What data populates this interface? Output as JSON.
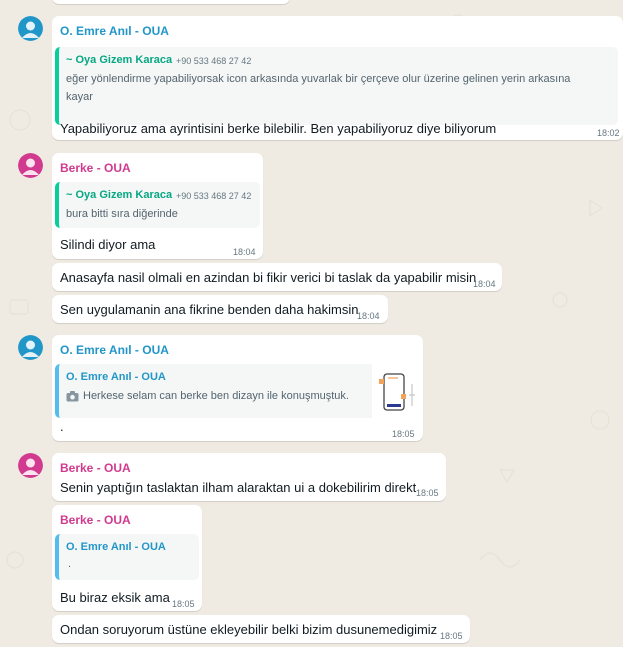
{
  "colors": {
    "background": "#efeae2",
    "bubble": "#ffffff",
    "emre": "#2196c8",
    "berke": "#d13a8e",
    "oya": "#06a884",
    "timestamp": "#667781"
  },
  "messages": {
    "m1": {
      "sender": "O. Emre Anıl - OUA",
      "quote_name": "~ Oya Gizem Karaca",
      "quote_phone": "+90 533 468 27 42",
      "quote_line1": "eğer yönlendirme yapabiliyorsak icon arkasında yuvarlak bir çerçeve olur üzerine gelinen yerin arkasına",
      "quote_line2": "kayar",
      "text": "Yapabiliyoruz ama ayrintisini berke bilebilir. Ben yapabiliyoruz diye biliyorum",
      "time": "18:02"
    },
    "m2": {
      "sender": "Berke - OUA",
      "quote_name": "~ Oya Gizem Karaca",
      "quote_phone": "+90 533 468 27 42",
      "quote_text": "bura bitti sıra diğerinde",
      "text": "Silindi diyor ama",
      "time": "18:04"
    },
    "m3": {
      "text": "Anasayfa nasil olmali en azindan bi fikir verici bi taslak da yapabilir misin",
      "time": "18:04"
    },
    "m4": {
      "text": "Sen uygulamanin ana fikrine benden daha hakimsin",
      "time": "18:04"
    },
    "m5": {
      "sender": "O. Emre Anıl - OUA",
      "quote_name": "O. Emre Anıl - OUA",
      "quote_text": "Herkese selam can berke ben dizayn ile konuşmuştuk.",
      "text": ".",
      "time": "18:05"
    },
    "m6": {
      "sender": "Berke - OUA",
      "text": "Senin yaptığın taslaktan ilham alaraktan ui a dokebilirim direkt",
      "time": "18:05"
    },
    "m7": {
      "sender": "Berke - OUA",
      "quote_name": "O. Emre Anıl - OUA",
      "quote_text": ".",
      "text": "Bu biraz eksik ama",
      "time": "18:05"
    },
    "m8": {
      "text": "Ondan soruyorum üstüne ekleyebilir belki bizim dusunemedigimiz",
      "time": "18:05"
    }
  }
}
